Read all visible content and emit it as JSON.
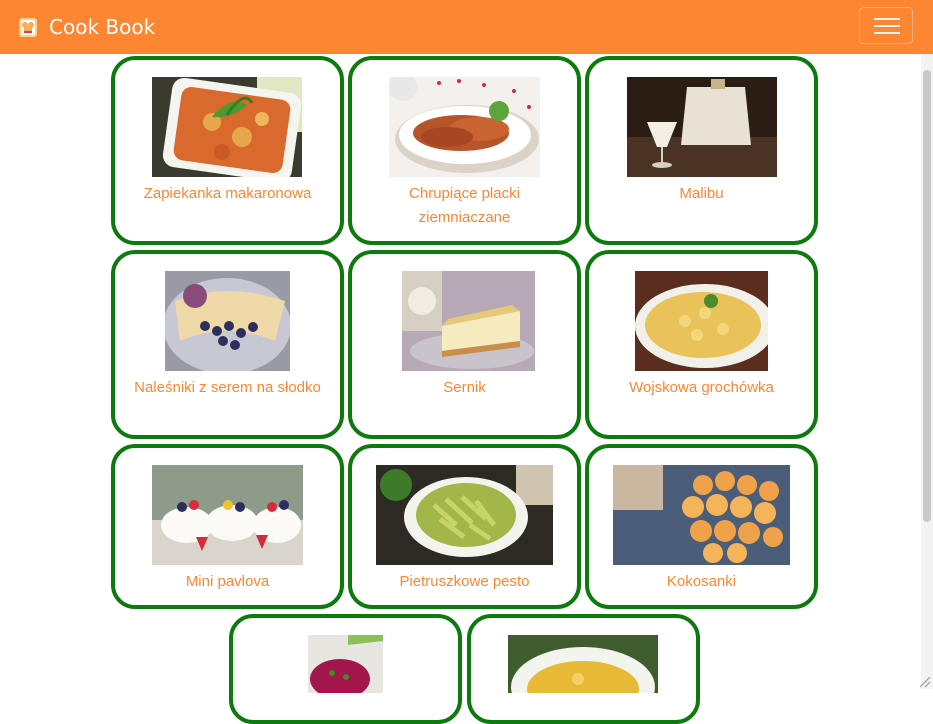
{
  "app": {
    "title": "Cook Book",
    "brand_color": "#fd8632",
    "card_border_color": "#0d7a0d",
    "icons": {
      "logo": "chef-hat-icon",
      "menu": "hamburger-menu-icon"
    }
  },
  "recipes": [
    {
      "name": "Zapiekanka makaronowa",
      "image": "baked-pasta-casserole"
    },
    {
      "name": "Chrupiące placki ziemniaczane",
      "image": "crispy-potato-pancakes"
    },
    {
      "name": "Malibu",
      "image": "malibu-drink"
    },
    {
      "name": "Naleśniki z serem na słodko",
      "image": "crepes-with-blueberries"
    },
    {
      "name": "Sernik",
      "image": "cheesecake-slice"
    },
    {
      "name": "Wojskowa grochówka",
      "image": "pea-soup"
    },
    {
      "name": "Mini pavlova",
      "image": "mini-pavlovas"
    },
    {
      "name": "Pietruszkowe pesto",
      "image": "parsley-pesto-pasta"
    },
    {
      "name": "Kokosanki",
      "image": "coconut-macaroons"
    },
    {
      "name": "",
      "image": "beet-salad"
    },
    {
      "name": "",
      "image": "yellow-soup"
    }
  ]
}
